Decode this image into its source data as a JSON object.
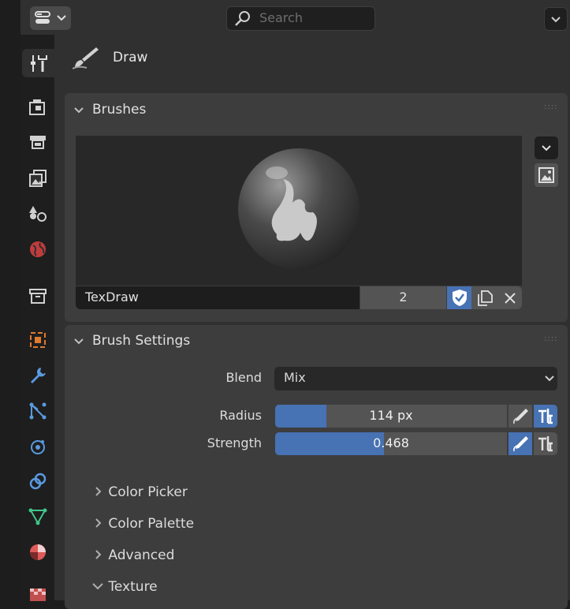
{
  "header": {
    "search_placeholder": "Search"
  },
  "tabs": [
    "tool-icon",
    "render-icon",
    "output-icon",
    "view-layer-icon",
    "scene-icon",
    "world-icon",
    "collection-icon",
    "object-icon",
    "modifier-icon",
    "particles-icon",
    "physics-icon",
    "constraints-icon",
    "data-icon",
    "material-icon",
    "texture-icon"
  ],
  "tool": {
    "title": "Draw"
  },
  "brushes": {
    "title": "Brushes",
    "name": "TexDraw",
    "users": "2"
  },
  "brush_settings": {
    "title": "Brush Settings",
    "blend_label": "Blend",
    "blend_value": "Mix",
    "radius_label": "Radius",
    "radius_value": "114 px",
    "radius_fill": 0.22,
    "strength_label": "Strength",
    "strength_value": "0.468",
    "strength_fill": 0.468
  },
  "sub_panels": [
    {
      "label": "Color Picker",
      "expanded": false
    },
    {
      "label": "Color Palette",
      "expanded": false
    },
    {
      "label": "Advanced",
      "expanded": false
    },
    {
      "label": "Texture",
      "expanded": true
    }
  ],
  "colors": {
    "accent": "#4772b3",
    "panel": "#3d3d3d",
    "background": "#303030"
  }
}
